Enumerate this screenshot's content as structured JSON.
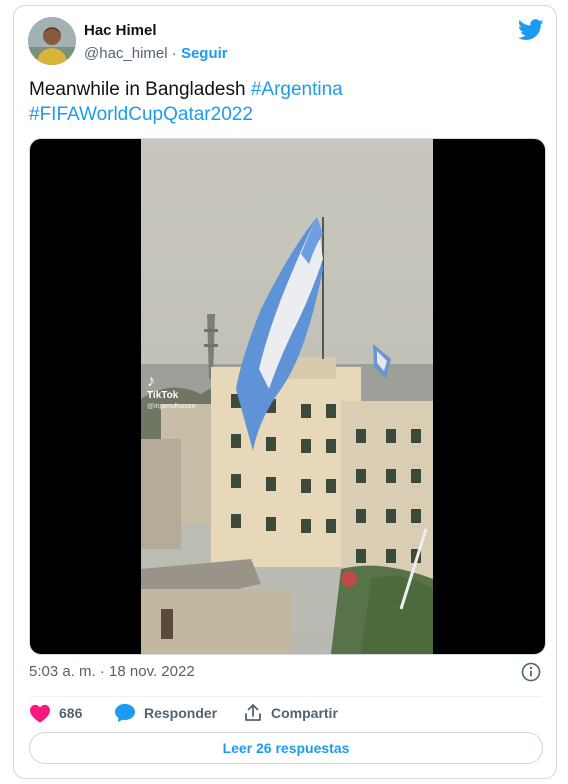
{
  "author": {
    "name": "Hac Himel",
    "handle": "@hac_himel",
    "separator": "·",
    "follow_label": "Seguir"
  },
  "tweet": {
    "text": "Meanwhile in Bangladesh",
    "hashtags": [
      "#Argentina",
      "#FIFAWorldCupQatar2022"
    ]
  },
  "media": {
    "watermark_brand": "TikTok",
    "watermark_user": "@injamulhasan"
  },
  "meta": {
    "timestamp": "5:03 a. m. · 18 nov. 2022"
  },
  "actions": {
    "like_count": "686",
    "reply_label": "Responder",
    "share_label": "Compartir"
  },
  "read_replies_label": "Leer 26 respuestas",
  "colors": {
    "accent": "#1d9bf0",
    "like": "#f91880",
    "text": "#0f1419",
    "muted": "#536471",
    "border": "#cfd9de"
  },
  "icons": {
    "logo": "twitter-bird-icon",
    "info": "info-icon",
    "like": "heart-icon",
    "reply": "reply-bubble-icon",
    "share": "share-upload-icon"
  }
}
